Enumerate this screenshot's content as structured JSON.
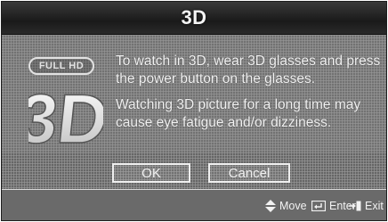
{
  "dialog": {
    "title": "3D",
    "badge_text": "FULL HD",
    "logo_text": "3D",
    "messages": [
      "To watch in 3D, wear 3D glasses and press the power button on the glasses.",
      "Watching 3D picture for a long time may cause eye fatigue and/or dizziness."
    ],
    "buttons": {
      "ok": "OK",
      "cancel": "Cancel"
    }
  },
  "footer": {
    "move_label": "Move",
    "enter_label": "Enter",
    "exit_label": "Exit",
    "icons": [
      "move-arrows-icon",
      "enter-icon",
      "exit-icon"
    ]
  }
}
